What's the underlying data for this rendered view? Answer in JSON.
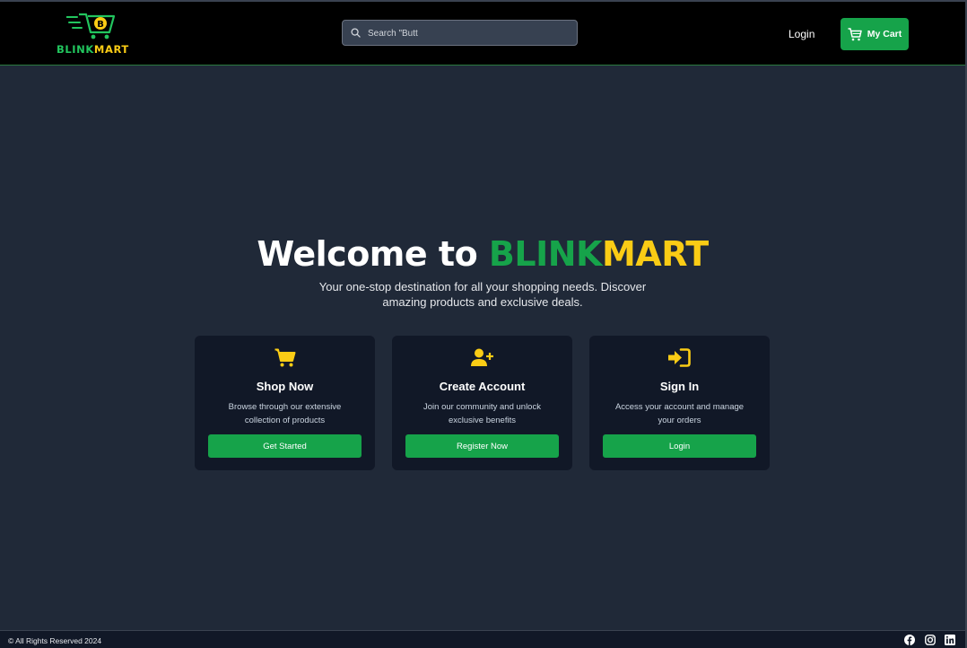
{
  "header": {
    "logo": {
      "brand_part1": "BLINK",
      "brand_part2": "MART",
      "badge_letter": "B"
    },
    "search": {
      "value": "",
      "placeholder": "Search \"Butt"
    },
    "login_label": "Login",
    "cart_label": "My Cart"
  },
  "hero": {
    "title_prefix": "Welcome to ",
    "title_brand_part1": "BLINK",
    "title_brand_part2": "MART",
    "subtitle": "Your one-stop destination for all your shopping needs. Discover amazing products and exclusive deals."
  },
  "cards": [
    {
      "icon": "cart-icon",
      "title": "Shop Now",
      "description": "Browse through our extensive collection of products",
      "button": "Get Started"
    },
    {
      "icon": "user-plus-icon",
      "title": "Create Account",
      "description": "Join our community and unlock exclusive benefits",
      "button": "Register Now"
    },
    {
      "icon": "sign-in-icon",
      "title": "Sign In",
      "description": "Access your account and manage your orders",
      "button": "Login"
    }
  ],
  "footer": {
    "copyright": "© All Rights Reserved 2024",
    "social_icons": [
      "facebook-icon",
      "instagram-icon",
      "linkedin-icon"
    ]
  },
  "colors": {
    "background": "#202938",
    "header": "#000000",
    "card": "#111827",
    "accent_green": "#16a34a",
    "accent_yellow": "#facc15"
  }
}
